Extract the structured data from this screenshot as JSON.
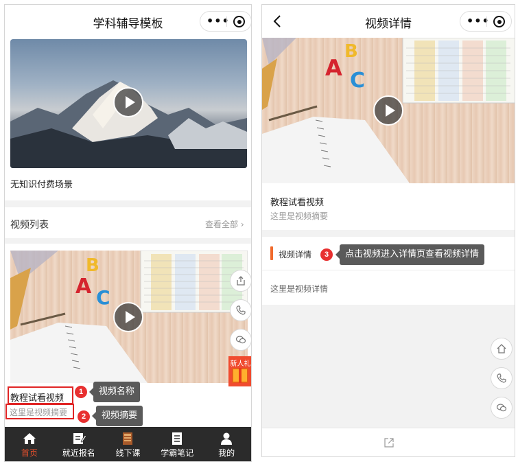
{
  "left": {
    "nav": {
      "title": "学科辅导模板",
      "more_icon": "more-dots-icon",
      "close_icon": "target-icon"
    },
    "top_video": {
      "caption": "无知识付费场景"
    },
    "video_list": {
      "title": "视频列表",
      "more": "查看全部",
      "item": {
        "name": "教程试看视频",
        "summary": "这里是视频摘要"
      }
    },
    "floating": [
      "share-icon",
      "phone-icon",
      "wechat-icon"
    ],
    "gift": {
      "label": "新人礼"
    },
    "annotations": [
      {
        "num": "1",
        "text": "视频名称"
      },
      {
        "num": "2",
        "text": "视频摘要"
      }
    ],
    "tabbar": [
      {
        "label": "首页",
        "icon": "home-icon",
        "active": true
      },
      {
        "label": "就近报名",
        "icon": "form-edit-icon",
        "active": false
      },
      {
        "label": "线下课",
        "icon": "book-icon",
        "active": false
      },
      {
        "label": "学霸笔记",
        "icon": "notes-icon",
        "active": false
      },
      {
        "label": "我的",
        "icon": "user-icon",
        "active": false
      }
    ],
    "active_color": "#e8502c"
  },
  "right": {
    "nav": {
      "title": "视频详情",
      "back_icon": "back-arrow-icon"
    },
    "video": {
      "name": "教程试看视频",
      "summary": "这里是视频摘要"
    },
    "detail": {
      "tab_label": "视频详情",
      "content": "这里是视频详情"
    },
    "annotation": {
      "num": "3",
      "text": "点击视频进入详情页查看视频详情"
    },
    "floating": [
      "home-icon",
      "phone-icon",
      "wechat-icon"
    ],
    "bottom_icon": "edit-share-icon",
    "accent_color": "#f06a2c"
  }
}
